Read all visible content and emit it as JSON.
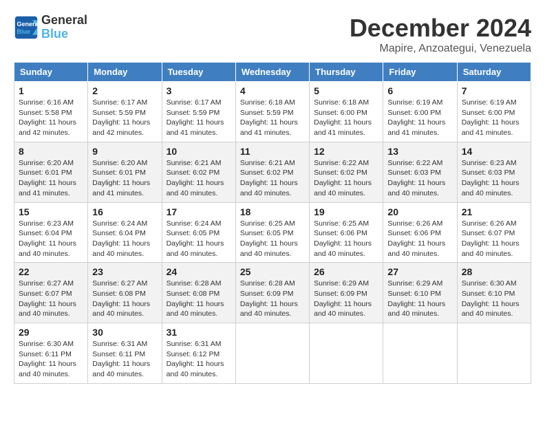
{
  "logo": {
    "line1": "General",
    "line2": "Blue"
  },
  "title": "December 2024",
  "location": "Mapire, Anzoategui, Venezuela",
  "headers": [
    "Sunday",
    "Monday",
    "Tuesday",
    "Wednesday",
    "Thursday",
    "Friday",
    "Saturday"
  ],
  "weeks": [
    [
      {
        "day": 1,
        "sunrise": "6:16 AM",
        "sunset": "5:58 PM",
        "daylight": "11 hours and 42 minutes."
      },
      {
        "day": 2,
        "sunrise": "6:17 AM",
        "sunset": "5:59 PM",
        "daylight": "11 hours and 42 minutes."
      },
      {
        "day": 3,
        "sunrise": "6:17 AM",
        "sunset": "5:59 PM",
        "daylight": "11 hours and 41 minutes."
      },
      {
        "day": 4,
        "sunrise": "6:18 AM",
        "sunset": "5:59 PM",
        "daylight": "11 hours and 41 minutes."
      },
      {
        "day": 5,
        "sunrise": "6:18 AM",
        "sunset": "6:00 PM",
        "daylight": "11 hours and 41 minutes."
      },
      {
        "day": 6,
        "sunrise": "6:19 AM",
        "sunset": "6:00 PM",
        "daylight": "11 hours and 41 minutes."
      },
      {
        "day": 7,
        "sunrise": "6:19 AM",
        "sunset": "6:00 PM",
        "daylight": "11 hours and 41 minutes."
      }
    ],
    [
      {
        "day": 8,
        "sunrise": "6:20 AM",
        "sunset": "6:01 PM",
        "daylight": "11 hours and 41 minutes."
      },
      {
        "day": 9,
        "sunrise": "6:20 AM",
        "sunset": "6:01 PM",
        "daylight": "11 hours and 41 minutes."
      },
      {
        "day": 10,
        "sunrise": "6:21 AM",
        "sunset": "6:02 PM",
        "daylight": "11 hours and 40 minutes."
      },
      {
        "day": 11,
        "sunrise": "6:21 AM",
        "sunset": "6:02 PM",
        "daylight": "11 hours and 40 minutes."
      },
      {
        "day": 12,
        "sunrise": "6:22 AM",
        "sunset": "6:02 PM",
        "daylight": "11 hours and 40 minutes."
      },
      {
        "day": 13,
        "sunrise": "6:22 AM",
        "sunset": "6:03 PM",
        "daylight": "11 hours and 40 minutes."
      },
      {
        "day": 14,
        "sunrise": "6:23 AM",
        "sunset": "6:03 PM",
        "daylight": "11 hours and 40 minutes."
      }
    ],
    [
      {
        "day": 15,
        "sunrise": "6:23 AM",
        "sunset": "6:04 PM",
        "daylight": "11 hours and 40 minutes."
      },
      {
        "day": 16,
        "sunrise": "6:24 AM",
        "sunset": "6:04 PM",
        "daylight": "11 hours and 40 minutes."
      },
      {
        "day": 17,
        "sunrise": "6:24 AM",
        "sunset": "6:05 PM",
        "daylight": "11 hours and 40 minutes."
      },
      {
        "day": 18,
        "sunrise": "6:25 AM",
        "sunset": "6:05 PM",
        "daylight": "11 hours and 40 minutes."
      },
      {
        "day": 19,
        "sunrise": "6:25 AM",
        "sunset": "6:06 PM",
        "daylight": "11 hours and 40 minutes."
      },
      {
        "day": 20,
        "sunrise": "6:26 AM",
        "sunset": "6:06 PM",
        "daylight": "11 hours and 40 minutes."
      },
      {
        "day": 21,
        "sunrise": "6:26 AM",
        "sunset": "6:07 PM",
        "daylight": "11 hours and 40 minutes."
      }
    ],
    [
      {
        "day": 22,
        "sunrise": "6:27 AM",
        "sunset": "6:07 PM",
        "daylight": "11 hours and 40 minutes."
      },
      {
        "day": 23,
        "sunrise": "6:27 AM",
        "sunset": "6:08 PM",
        "daylight": "11 hours and 40 minutes."
      },
      {
        "day": 24,
        "sunrise": "6:28 AM",
        "sunset": "6:08 PM",
        "daylight": "11 hours and 40 minutes."
      },
      {
        "day": 25,
        "sunrise": "6:28 AM",
        "sunset": "6:09 PM",
        "daylight": "11 hours and 40 minutes."
      },
      {
        "day": 26,
        "sunrise": "6:29 AM",
        "sunset": "6:09 PM",
        "daylight": "11 hours and 40 minutes."
      },
      {
        "day": 27,
        "sunrise": "6:29 AM",
        "sunset": "6:10 PM",
        "daylight": "11 hours and 40 minutes."
      },
      {
        "day": 28,
        "sunrise": "6:30 AM",
        "sunset": "6:10 PM",
        "daylight": "11 hours and 40 minutes."
      }
    ],
    [
      {
        "day": 29,
        "sunrise": "6:30 AM",
        "sunset": "6:11 PM",
        "daylight": "11 hours and 40 minutes."
      },
      {
        "day": 30,
        "sunrise": "6:31 AM",
        "sunset": "6:11 PM",
        "daylight": "11 hours and 40 minutes."
      },
      {
        "day": 31,
        "sunrise": "6:31 AM",
        "sunset": "6:12 PM",
        "daylight": "11 hours and 40 minutes."
      },
      null,
      null,
      null,
      null
    ]
  ],
  "labels": {
    "sunrise_prefix": "Sunrise: ",
    "sunset_prefix": "Sunset: ",
    "daylight_prefix": "Daylight: "
  }
}
